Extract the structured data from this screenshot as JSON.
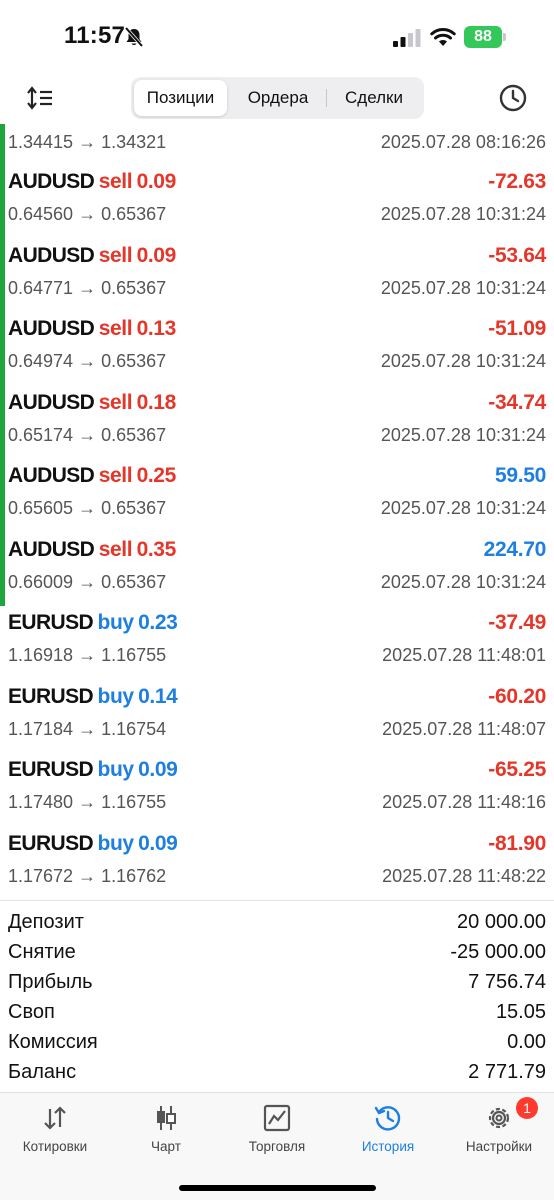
{
  "status": {
    "time": "11:57",
    "battery": "88"
  },
  "header": {
    "tabs": [
      {
        "label": "Позиции",
        "active": true
      },
      {
        "label": "Ордера",
        "active": false
      },
      {
        "label": "Сделки",
        "active": false
      }
    ]
  },
  "first_row": {
    "prices": "1.34415 → 1.34321",
    "time": "2025.07.28 08:16:26"
  },
  "deals": [
    {
      "symbol": "AUDUSD",
      "dir": "sell",
      "volume": "0.09",
      "profit": "-72.63",
      "prices": "0.64560 → 0.65367",
      "time": "2025.07.28 10:31:24"
    },
    {
      "symbol": "AUDUSD",
      "dir": "sell",
      "volume": "0.09",
      "profit": "-53.64",
      "prices": "0.64771 → 0.65367",
      "time": "2025.07.28 10:31:24"
    },
    {
      "symbol": "AUDUSD",
      "dir": "sell",
      "volume": "0.13",
      "profit": "-51.09",
      "prices": "0.64974 → 0.65367",
      "time": "2025.07.28 10:31:24"
    },
    {
      "symbol": "AUDUSD",
      "dir": "sell",
      "volume": "0.18",
      "profit": "-34.74",
      "prices": "0.65174 → 0.65367",
      "time": "2025.07.28 10:31:24"
    },
    {
      "symbol": "AUDUSD",
      "dir": "sell",
      "volume": "0.25",
      "profit": "59.50",
      "prices": "0.65605 → 0.65367",
      "time": "2025.07.28 10:31:24"
    },
    {
      "symbol": "AUDUSD",
      "dir": "sell",
      "volume": "0.35",
      "profit": "224.70",
      "prices": "0.66009 → 0.65367",
      "time": "2025.07.28 10:31:24"
    },
    {
      "symbol": "EURUSD",
      "dir": "buy",
      "volume": "0.23",
      "profit": "-37.49",
      "prices": "1.16918 → 1.16755",
      "time": "2025.07.28 11:48:01"
    },
    {
      "symbol": "EURUSD",
      "dir": "buy",
      "volume": "0.14",
      "profit": "-60.20",
      "prices": "1.17184 → 1.16754",
      "time": "2025.07.28 11:48:07"
    },
    {
      "symbol": "EURUSD",
      "dir": "buy",
      "volume": "0.09",
      "profit": "-65.25",
      "prices": "1.17480 → 1.16755",
      "time": "2025.07.28 11:48:16"
    },
    {
      "symbol": "EURUSD",
      "dir": "buy",
      "volume": "0.09",
      "profit": "-81.90",
      "prices": "1.17672 → 1.16762",
      "time": "2025.07.28 11:48:22"
    }
  ],
  "summary": [
    {
      "label": "Депозит",
      "value": "20 000.00"
    },
    {
      "label": "Снятие",
      "value": "-25 000.00"
    },
    {
      "label": "Прибыль",
      "value": "7 756.74"
    },
    {
      "label": "Своп",
      "value": "15.05"
    },
    {
      "label": "Комиссия",
      "value": "0.00"
    },
    {
      "label": "Баланс",
      "value": "2 771.79"
    }
  ],
  "tabbar": {
    "items": [
      {
        "label": "Котировки",
        "icon": "quotes-icon"
      },
      {
        "label": "Чарт",
        "icon": "chart-icon"
      },
      {
        "label": "Торговля",
        "icon": "trade-icon"
      },
      {
        "label": "История",
        "icon": "history-icon",
        "active": true
      },
      {
        "label": "Настройки",
        "icon": "gear-icon",
        "badge": "1"
      }
    ]
  },
  "colors": {
    "sell": "#e5362a",
    "buy": "#1e7fe0",
    "accent": "#1e7fe0",
    "bar": "#1ea53b"
  }
}
